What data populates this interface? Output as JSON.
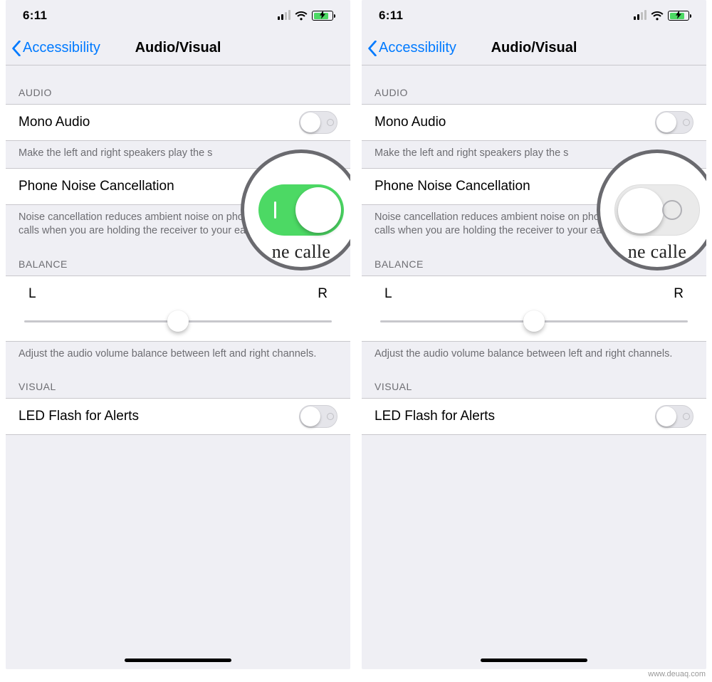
{
  "watermark": "www.deuaq.com",
  "screens": [
    {
      "status": {
        "time": "6:11"
      },
      "nav": {
        "back": "Accessibility",
        "title": "Audio/Visual"
      },
      "audio": {
        "header": "AUDIO",
        "mono": {
          "label": "Mono Audio",
          "on": false
        },
        "mono_note": "Make the left and right speakers play the s",
        "noise": {
          "label": "Phone Noise Cancellation",
          "on": true
        },
        "noise_note": "Noise cancellation reduces ambient noise on phone calls when you are holding the receiver to your ear."
      },
      "balance": {
        "header": "BALANCE",
        "left_label": "L",
        "right_label": "R",
        "value_pct": 50,
        "note": "Adjust the audio volume balance between left and right channels."
      },
      "visual": {
        "header": "VISUAL",
        "led": {
          "label": "LED Flash for Alerts",
          "on": false
        }
      },
      "magnifier": {
        "on": true,
        "partial_text": "ne calle"
      }
    },
    {
      "status": {
        "time": "6:11"
      },
      "nav": {
        "back": "Accessibility",
        "title": "Audio/Visual"
      },
      "audio": {
        "header": "AUDIO",
        "mono": {
          "label": "Mono Audio",
          "on": false
        },
        "mono_note": "Make the left and right speakers play the s",
        "noise": {
          "label": "Phone Noise Cancellation",
          "on": false
        },
        "noise_note": "Noise cancellation reduces ambient noise on phone calls when you are holding the receiver to your ear."
      },
      "balance": {
        "header": "BALANCE",
        "left_label": "L",
        "right_label": "R",
        "value_pct": 50,
        "note": "Adjust the audio volume balance between left and right channels."
      },
      "visual": {
        "header": "VISUAL",
        "led": {
          "label": "LED Flash for Alerts",
          "on": false
        }
      },
      "magnifier": {
        "on": false,
        "partial_text": "ne calle"
      }
    }
  ]
}
